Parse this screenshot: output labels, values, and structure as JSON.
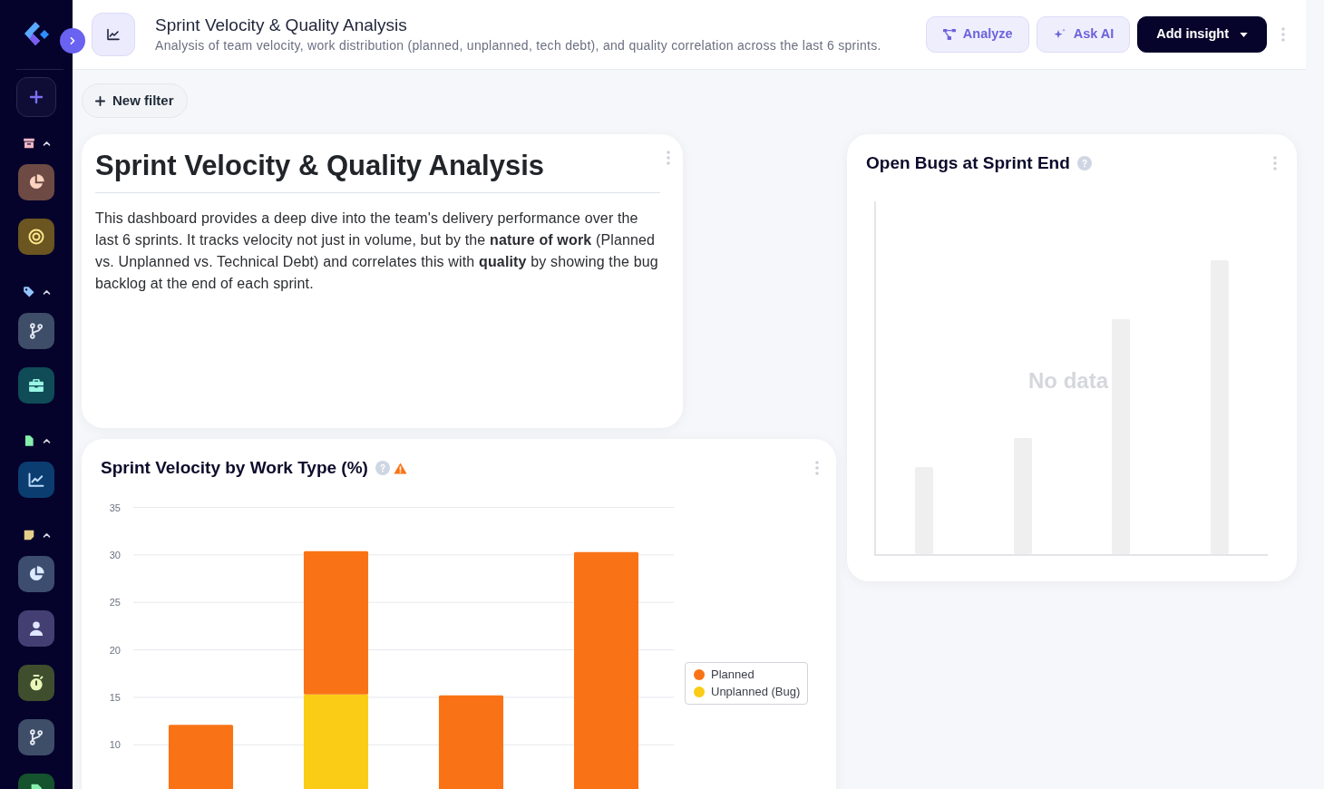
{
  "sidebar": {
    "sections": [
      {
        "color": "#f2b8c6",
        "expanded": true,
        "items": [
          {
            "color": "#6e4a45"
          },
          {
            "color": "#6b5520"
          }
        ]
      },
      {
        "color": "#93c5fd",
        "expanded": true,
        "items": [
          {
            "color": "#3e4d68"
          },
          {
            "color": "#0f4c57"
          }
        ]
      },
      {
        "color": "#86efac",
        "expanded": true,
        "items": [
          {
            "color": "#0b3d70"
          }
        ]
      },
      {
        "color": "#e4cf8a",
        "expanded": true,
        "items": [
          {
            "color": "#3d4d70"
          },
          {
            "color": "#433f72"
          },
          {
            "color": "#3f4f2e"
          },
          {
            "color": "#3e4d68"
          },
          {
            "color": "#14532d"
          }
        ]
      }
    ]
  },
  "header": {
    "title": "Sprint Velocity & Quality Analysis",
    "subtitle": "Analysis of team velocity, work distribution (planned, unplanned, tech debt), and quality correlation across the last 6 sprints.",
    "buttons": [
      {
        "label": "Analyze",
        "kind": "secondary",
        "dropdown": false
      },
      {
        "label": "Ask AI",
        "kind": "secondary",
        "dropdown": false
      },
      {
        "label": "Add insight",
        "kind": "primary",
        "dropdown": true
      }
    ]
  },
  "filters": {
    "new_filter": "New filter"
  },
  "cards": [
    {
      "kind": "text",
      "heading": "Sprint Velocity & Quality Analysis",
      "body": "This dashboard provides a deep dive into the team's delivery performance over the last 6 sprints. It tracks velocity not just in volume, but by the **nature of work** (Planned vs. Unplanned vs. Technical Debt) and correlates this with **quality** by showing the bug backlog at the end of each sprint."
    },
    {
      "kind": "chart",
      "title": "Sprint Velocity by Work Type (%)",
      "help": true,
      "warning": true,
      "chart_data": {
        "type": "bar",
        "stacked": true,
        "grid": true,
        "legend": true,
        "ylim": [
          0,
          35
        ],
        "yticks": [
          10,
          15,
          20,
          25,
          30,
          35
        ],
        "series": [
          {
            "name": "Planned",
            "color": "#f97316",
            "values": [
              12.1,
              15.1,
              15.2,
              30.3
            ]
          },
          {
            "name": "Unplanned (Bug)",
            "color": "#facc15",
            "values": [
              null,
              15.3,
              null,
              null
            ]
          }
        ]
      }
    },
    {
      "kind": "empty",
      "title": "Open Bugs at Sprint End",
      "help": true,
      "empty_text": "No data"
    }
  ]
}
